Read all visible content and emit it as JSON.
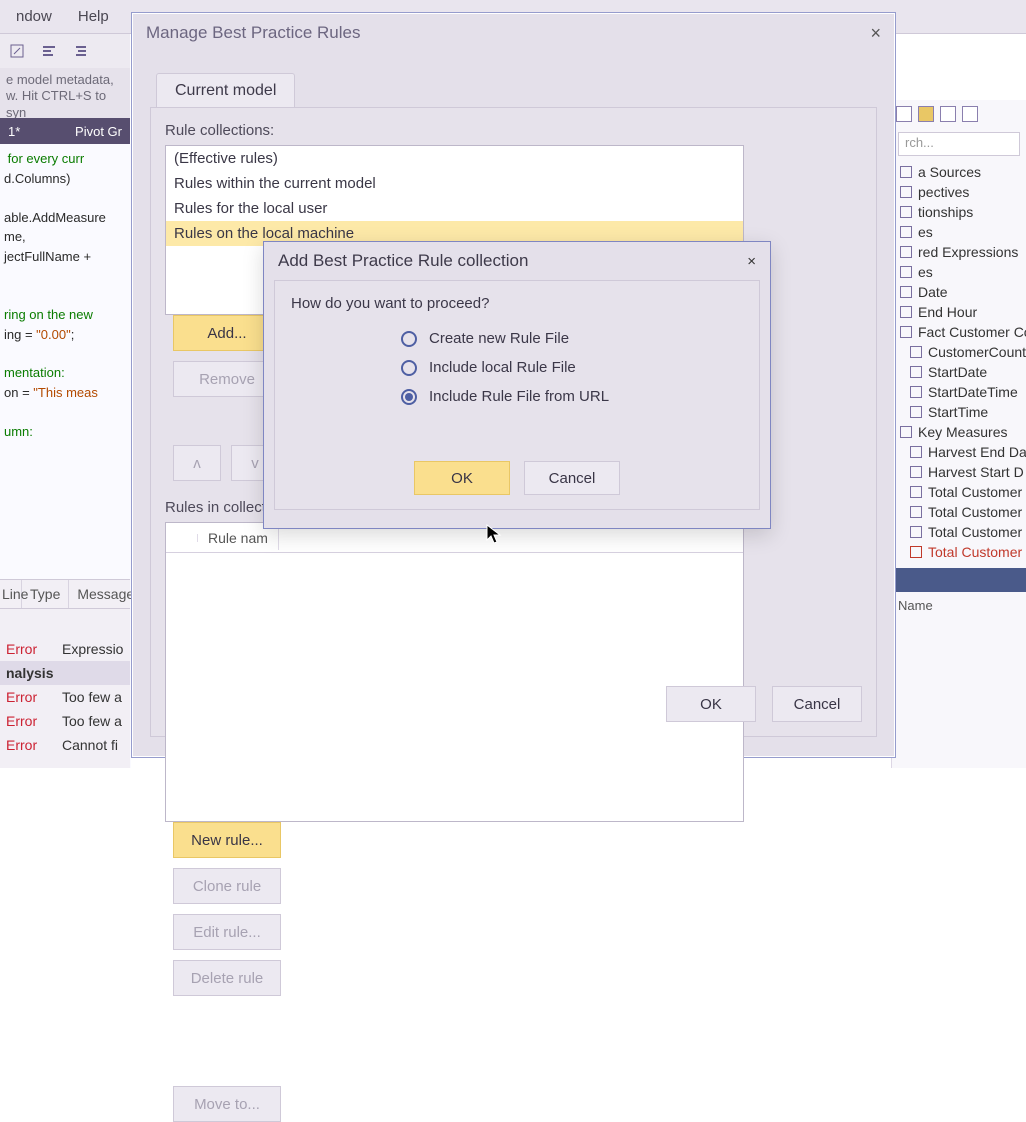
{
  "menu": {
    "window": "ndow",
    "help": "Help"
  },
  "tip": "e model metadata, w. Hit CTRL+S to syn",
  "tabs": {
    "file": "1*",
    "right": "Pivot Gr"
  },
  "code": {
    "l1": " for every curr",
    "l2": "d.Columns)",
    "l3": "able.AddMeasure",
    "l4": "me,",
    "l5": "jectFullName + ",
    "l6": "ring on the new",
    "l7a": "ing = ",
    "l7b": "\"0.00\"",
    "l7c": ";",
    "l8": "mentation:",
    "l9a": "on = ",
    "l9b": "\"This meas",
    "l10": "umn:"
  },
  "messages": {
    "colLine": "Line",
    "col1": "Type",
    "col2": "Message",
    "r1a": "Error",
    "r1b": "Expressio",
    "sec": "nalysis",
    "r2a": "Error",
    "r2b": "Too few a",
    "r3a": "Error",
    "r3b": "Too few a",
    "r4a": "Error",
    "r4b": "Cannot fi"
  },
  "explorer": {
    "searchPlaceholder": "rch...",
    "nodes": [
      "a Sources",
      "pectives",
      "tionships",
      "es",
      "red Expressions",
      "es",
      "Date",
      "End Hour",
      "Fact Customer Cou",
      "CustomerCount",
      "StartDate",
      "StartDateTime",
      "StartTime",
      "Key Measures",
      "Harvest End Da",
      "Harvest Start D",
      "Total Customer",
      "Total Customer",
      "Total Customer",
      "Total Customer"
    ],
    "propsHead": "Name"
  },
  "dlg1": {
    "title": "Manage Best Practice Rules",
    "tab": "Current model",
    "collectionsLabel": "Rule collections:",
    "items": [
      "(Effective rules)",
      "Rules within the current model",
      "Rules for the local user",
      "Rules on the local machine"
    ],
    "add": "Add...",
    "remove": "Remove",
    "up": "ʌ",
    "down": "v",
    "section2": "Rules in collecti",
    "gridCol": "Rule nam",
    "newRule": "New rule...",
    "clone": "Clone rule",
    "edit": "Edit rule...",
    "delete": "Delete rule",
    "move": "Move to...",
    "ok": "OK",
    "cancel": "Cancel"
  },
  "dlg2": {
    "title": "Add Best Practice Rule collection",
    "question": "How do you want to proceed?",
    "opt1": "Create new Rule File",
    "opt2": "Include local Rule File",
    "opt3": "Include Rule File from URL",
    "ok": "OK",
    "cancel": "Cancel"
  }
}
